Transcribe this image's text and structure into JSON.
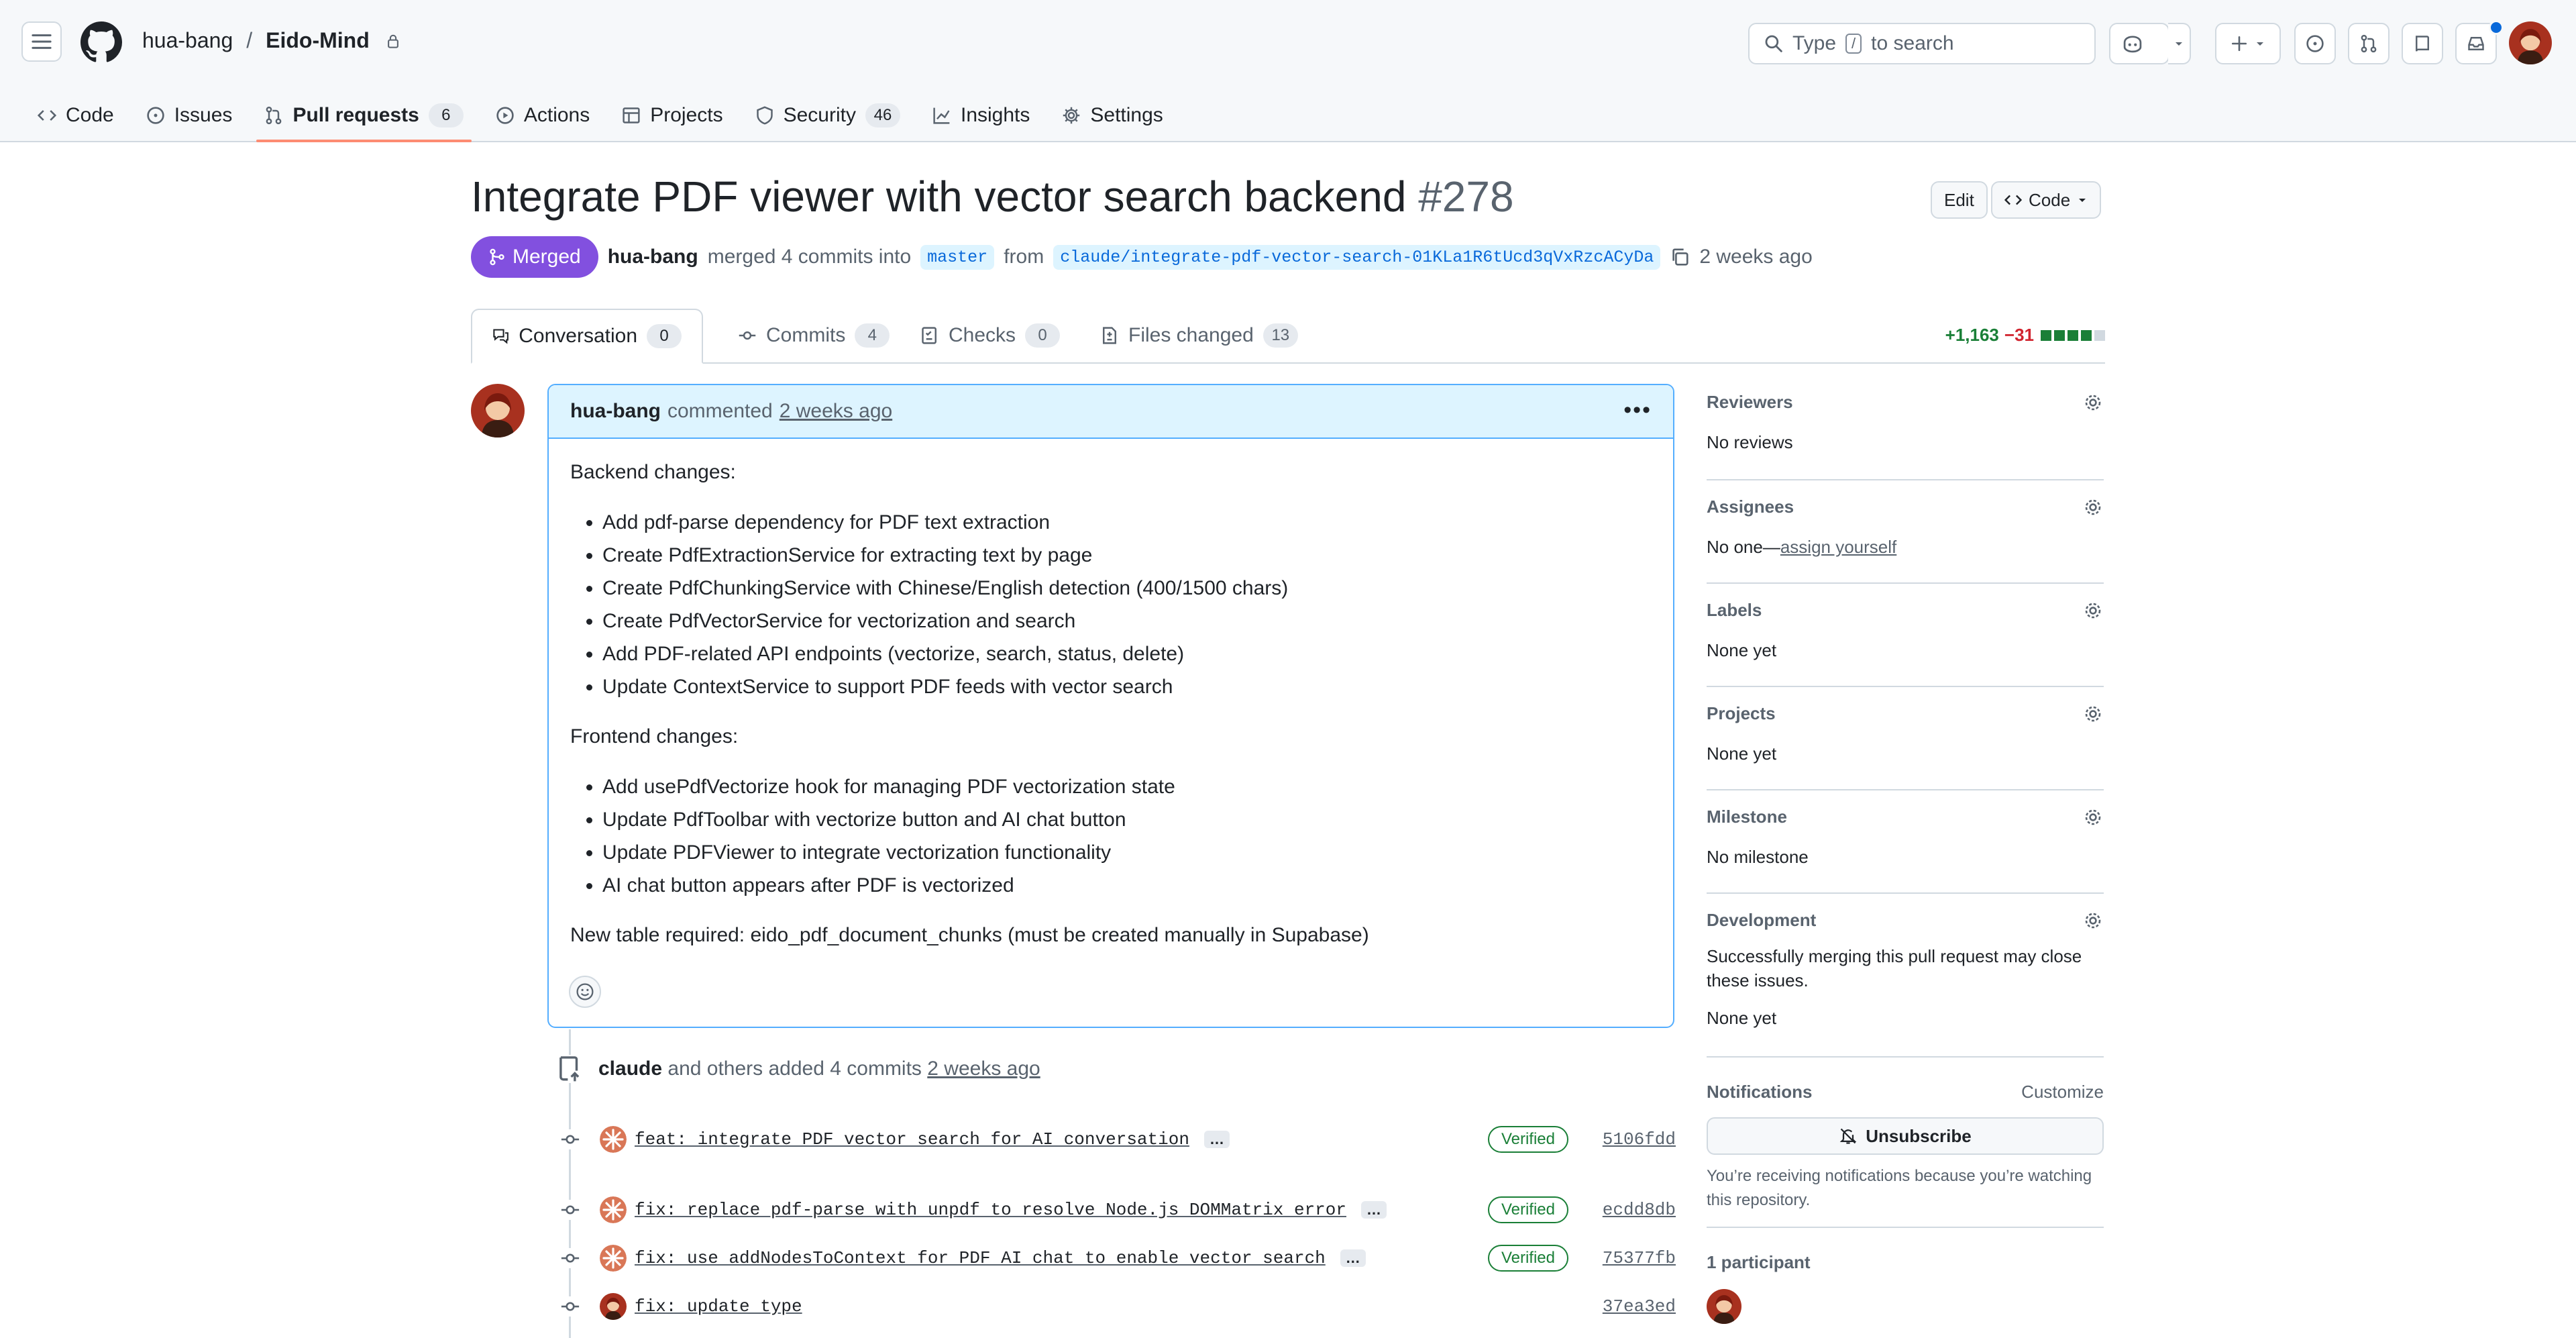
{
  "header": {
    "owner": "hua-bang",
    "separator": "/",
    "repo": "Eido-Mind",
    "search_before": "Type",
    "search_key": "/",
    "search_after": "to search"
  },
  "nav": {
    "code": "Code",
    "issues": "Issues",
    "pull_requests": "Pull requests",
    "pull_requests_count": "6",
    "actions": "Actions",
    "projects": "Projects",
    "security": "Security",
    "security_count": "46",
    "insights": "Insights",
    "settings": "Settings"
  },
  "pr": {
    "title": "Integrate PDF viewer with vector search backend",
    "number": "#278",
    "edit_label": "Edit",
    "code_label": "Code",
    "status": "Merged",
    "author": "hua-bang",
    "merged_text": "merged 4 commits into",
    "base_branch": "master",
    "from_text": "from",
    "head_branch": "claude/integrate-pdf-vector-search-01KLa1R6tUcd3qVxRzcACyDa",
    "time": "2 weeks ago"
  },
  "tabs": {
    "conversation": "Conversation",
    "conversation_count": "0",
    "commits": "Commits",
    "commits_count": "4",
    "checks": "Checks",
    "checks_count": "0",
    "files": "Files changed",
    "files_count": "13",
    "additions": "+1,163",
    "deletions": "−31"
  },
  "comment": {
    "author": "hua-bang",
    "action": "commented",
    "time": "2 weeks ago",
    "backend_heading": "Backend changes:",
    "backend_items": [
      "Add pdf-parse dependency for PDF text extraction",
      "Create PdfExtractionService for extracting text by page",
      "Create PdfChunkingService with Chinese/English detection (400/1500 chars)",
      "Create PdfVectorService for vectorization and search",
      "Add PDF-related API endpoints (vectorize, search, status, delete)",
      "Update ContextService to support PDF feeds with vector search"
    ],
    "frontend_heading": "Frontend changes:",
    "frontend_items": [
      "Add usePdfVectorize hook for managing PDF vectorization state",
      "Update PdfToolbar with vectorize button and AI chat button",
      "Update PDFViewer to integrate vectorization functionality",
      "AI chat button appears after PDF is vectorized"
    ],
    "footer": "New table required: eido_pdf_document_chunks (must be created manually in Supabase)"
  },
  "timeline": {
    "actor": "claude",
    "action": "and others added 4 commits",
    "time": "2 weeks ago",
    "commits": [
      {
        "message": "feat: integrate PDF vector search for AI conversation",
        "verified": "Verified",
        "sha": "5106fdd"
      },
      {
        "message": "fix: replace pdf-parse with unpdf to resolve Node.js DOMMatrix error",
        "verified": "Verified",
        "sha": "ecdd8db"
      },
      {
        "message": "fix: use addNodesToContext for PDF AI chat to enable vector search",
        "verified": "Verified",
        "sha": "75377fb"
      },
      {
        "message": "fix: update type",
        "verified": "",
        "sha": "37ea3ed"
      }
    ],
    "ellipsis": "…"
  },
  "sidebar": {
    "reviewers_title": "Reviewers",
    "reviewers_value": "No reviews",
    "assignees_title": "Assignees",
    "assignees_prefix": "No one—",
    "assignees_link": "assign yourself",
    "labels_title": "Labels",
    "labels_value": "None yet",
    "projects_title": "Projects",
    "projects_value": "None yet",
    "milestone_title": "Milestone",
    "milestone_value": "No milestone",
    "development_title": "Development",
    "development_note": "Successfully merging this pull request may close these issues.",
    "development_value": "None yet",
    "notifications_title": "Notifications",
    "customize": "Customize",
    "unsubscribe": "Unsubscribe",
    "notifications_note": "You’re receiving notifications because you’re watching this repository.",
    "participants_title": "1 participant"
  },
  "colors": {
    "merged": "#8250df",
    "accent": "#0969da",
    "nav_underline": "#fd8c73",
    "additions": "#1a7f37",
    "deletions": "#d1242f"
  }
}
